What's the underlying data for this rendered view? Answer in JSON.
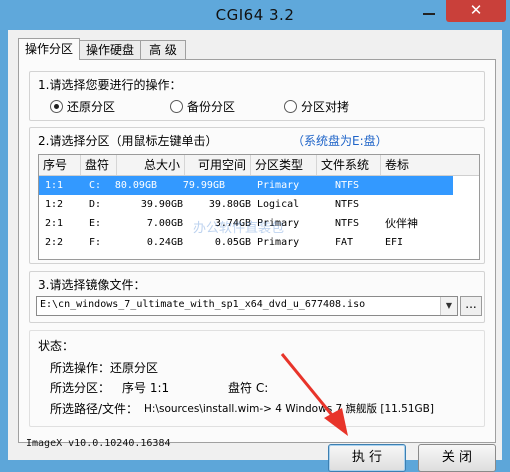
{
  "window": {
    "title": "CGI64  3.2",
    "close_glyph": "✕"
  },
  "tabs": [
    {
      "label": "操作分区",
      "active": true
    },
    {
      "label": "操作硬盘",
      "active": false
    },
    {
      "label": "高 级",
      "active": false
    }
  ],
  "step1": {
    "label": "1.请选择您要进行的操作：",
    "options": [
      {
        "label": "还原分区",
        "checked": true
      },
      {
        "label": "备份分区",
        "checked": false
      },
      {
        "label": "分区对拷",
        "checked": false
      }
    ]
  },
  "step2": {
    "label": "2.请选择分区（用鼠标左键单击）",
    "system_disk": "（系统盘为E:盘）",
    "columns": [
      "序号",
      "盘符",
      "总大小",
      "可用空间",
      "分区类型",
      "文件系统",
      "卷标"
    ],
    "rows": [
      {
        "index": "1:1",
        "drive": "C:",
        "total": "80.09GB",
        "free": "79.99GB",
        "type": "Primary",
        "fs": "NTFS",
        "label": "",
        "selected": true
      },
      {
        "index": "1:2",
        "drive": "D:",
        "total": "39.90GB",
        "free": "39.80GB",
        "type": "Logical",
        "fs": "NTFS",
        "label": "",
        "selected": false
      },
      {
        "index": "2:1",
        "drive": "E:",
        "total": "7.00GB",
        "free": "3.74GB",
        "type": "Primary",
        "fs": "NTFS",
        "label": "伙伴神",
        "selected": false
      },
      {
        "index": "2:2",
        "drive": "F:",
        "total": "0.24GB",
        "free": "0.05GB",
        "type": "Primary",
        "fs": "FAT",
        "label": "EFI",
        "selected": false
      }
    ],
    "watermark": "办公软件直装包"
  },
  "step3": {
    "label": "3.请选择镜像文件：",
    "value": "E:\\cn_windows_7_ultimate_with_sp1_x64_dvd_u_677408.iso",
    "browse_label": "..."
  },
  "status": {
    "heading": "状态：",
    "operation_label": "所选操作：",
    "operation_value": "还原分区",
    "partition_label": "所选分区：",
    "index_label": "序号 1:1",
    "drive_label": "盘符 C:",
    "path_label": "所选路径/文件：",
    "path_value": "H:\\sources\\install.wim-> 4  Windows 7 旗舰版 [11.51GB]"
  },
  "footer": {
    "version": "ImageX v10.0.10240.16384",
    "execute_label": "执 行",
    "close_label": "关 闭"
  },
  "colors": {
    "title_bar": "#5fa8db",
    "selection": "#3399ff",
    "accent_text": "#1f64c8",
    "arrow": "#e8342a",
    "close_button": "#c9403a"
  }
}
